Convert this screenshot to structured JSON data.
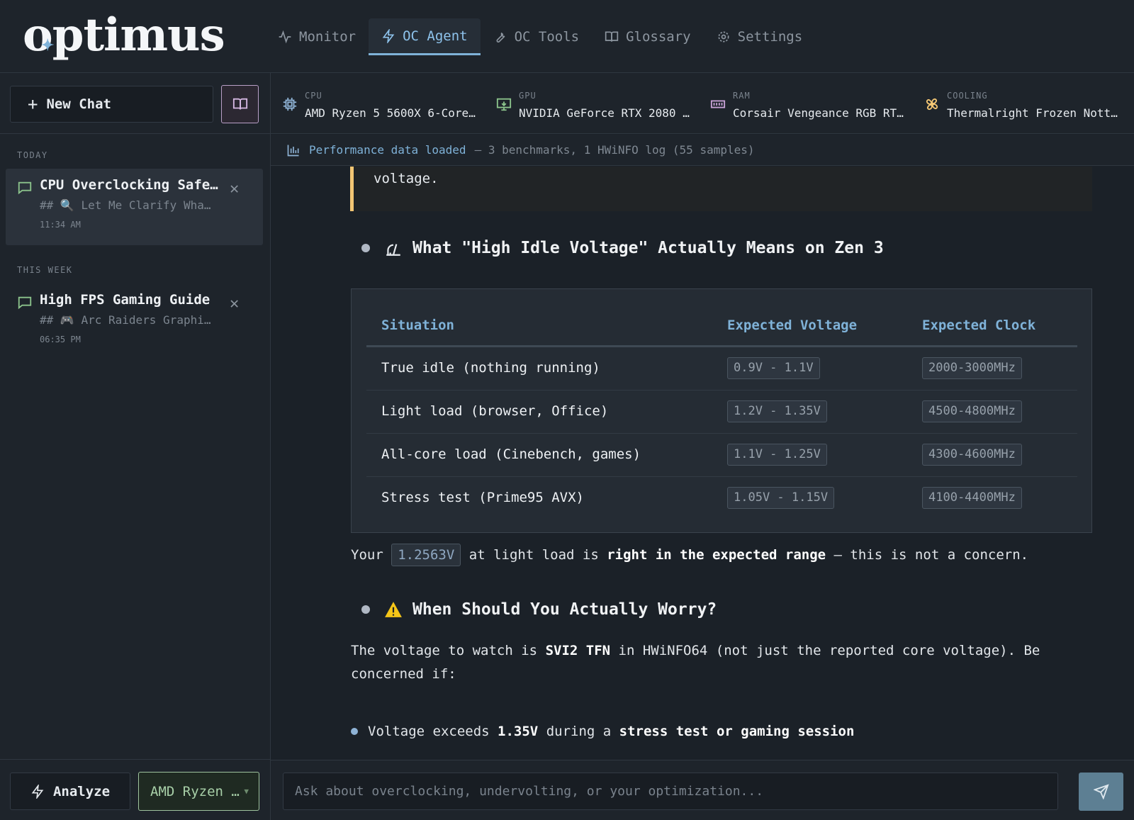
{
  "app": {
    "logo": "optimus"
  },
  "nav": [
    {
      "label": "Monitor",
      "icon": "activity-icon"
    },
    {
      "label": "OC Agent",
      "icon": "bolt-icon",
      "active": true
    },
    {
      "label": "OC Tools",
      "icon": "wrench-icon"
    },
    {
      "label": "Glossary",
      "icon": "book-icon"
    },
    {
      "label": "Settings",
      "icon": "gear-icon"
    }
  ],
  "sidebar": {
    "new_chat": "New Chat",
    "today_label": "TODAY",
    "week_label": "THIS WEEK",
    "chats": [
      {
        "title": "CPU Overclocking Safe…",
        "snippet": "## 🔍 Let Me Clarify Wha…",
        "time": "11:34 AM",
        "selected": true
      },
      {
        "title": "High FPS Gaming Guide",
        "snippet": "## 🎮 Arc Raiders Graphi…",
        "time": "06:35 PM",
        "selected": false
      }
    ],
    "analyze": "Analyze",
    "cpu_select": "AMD Ryzen …"
  },
  "hardware": [
    {
      "label": "CPU",
      "value": "AMD Ryzen 5 5600X 6-Core…",
      "icon": "chip-icon"
    },
    {
      "label": "GPU",
      "value": "NVIDIA GeForce RTX 2080 …",
      "icon": "monitor-icon"
    },
    {
      "label": "RAM",
      "value": "Corsair Vengeance RGB RT…",
      "icon": "memory-icon"
    },
    {
      "label": "COOLING",
      "value": "Thermalright Frozen Nott…",
      "icon": "fan-icon"
    }
  ],
  "perf": {
    "highlight": "Performance data loaded",
    "rest": "— 3 benchmarks, 1 HWiNFO log (55 samples)"
  },
  "message": {
    "quote_tail": "voltage.",
    "h1": "What \"High Idle Voltage\" Actually Means on Zen 3",
    "table": {
      "headers": [
        "Situation",
        "Expected Voltage",
        "Expected Clock"
      ],
      "rows": [
        {
          "situation": "True idle (nothing running)",
          "voltage": "0.9V - 1.1V",
          "clock": "2000-3000MHz"
        },
        {
          "situation": "Light load (browser, Office)",
          "voltage": "1.2V - 1.35V",
          "clock": "4500-4800MHz"
        },
        {
          "situation": "All-core load (Cinebench, games)",
          "voltage": "1.1V - 1.25V",
          "clock": "4300-4600MHz"
        },
        {
          "situation": "Stress test (Prime95 AVX)",
          "voltage": "1.05V - 1.15V",
          "clock": "4100-4400MHz"
        }
      ]
    },
    "p1": {
      "a": "Your",
      "code": "1.2563V",
      "b": "at light load is",
      "bold": "right in the expected range",
      "c": "— this is not a concern."
    },
    "h2": "When Should You Actually Worry?",
    "p2": {
      "a": "The voltage to watch is",
      "bold": "SVI2 TFN",
      "b": "in HWiNFO64 (not just the reported core voltage). Be",
      "c": "concerned if:"
    },
    "bullet": {
      "a": "Voltage exceeds",
      "b1": "1.35V",
      "b": "during a",
      "b2": "stress test or gaming session"
    }
  },
  "composer": {
    "placeholder": "Ask about overclocking, undervolting, or your optimization..."
  }
}
